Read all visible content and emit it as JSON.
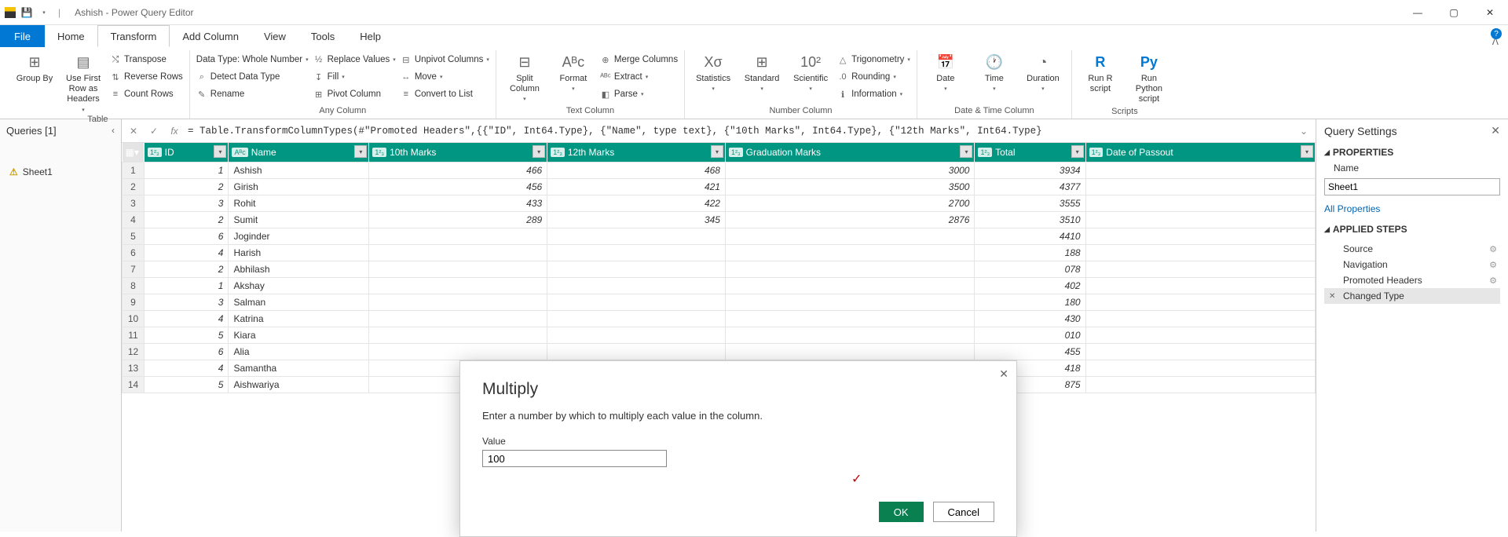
{
  "title": {
    "app_prefix": "Ashish",
    "app_name": "Power Query Editor"
  },
  "tabs": {
    "file": "File",
    "list": [
      "Home",
      "Transform",
      "Add Column",
      "View",
      "Tools",
      "Help"
    ],
    "active": 1
  },
  "ribbon": {
    "table_group": {
      "label": "Table",
      "group_by": "Group\nBy",
      "use_first_row": "Use First Row\nas Headers",
      "transpose": "Transpose",
      "reverse_rows": "Reverse Rows",
      "count_rows": "Count Rows"
    },
    "any_column_group": {
      "label": "Any Column",
      "data_type": "Data Type: Whole Number",
      "detect": "Detect Data Type",
      "rename": "Rename",
      "replace_values": "Replace Values",
      "fill": "Fill",
      "pivot": "Pivot Column",
      "unpivot": "Unpivot Columns",
      "move": "Move",
      "convert_list": "Convert to List"
    },
    "text_group": {
      "label": "Text Column",
      "split": "Split\nColumn",
      "format": "Format",
      "merge": "Merge Columns",
      "extract": "Extract",
      "parse": "Parse"
    },
    "number_group": {
      "label": "Number Column",
      "stats": "Statistics",
      "standard": "Standard",
      "scientific": "Scientific",
      "trig": "Trigonometry",
      "rounding": "Rounding",
      "info": "Information"
    },
    "datetime_group": {
      "label": "Date & Time Column",
      "date": "Date",
      "time": "Time",
      "duration": "Duration"
    },
    "scripts_group": {
      "label": "Scripts",
      "r": "Run R\nscript",
      "py": "Run Python\nscript"
    }
  },
  "formula_bar": {
    "text": "= Table.TransformColumnTypes(#\"Promoted Headers\",{{\"ID\", Int64.Type}, {\"Name\", type text}, {\"10th Marks\", Int64.Type}, {\"12th Marks\", Int64.Type}"
  },
  "queries_pane": {
    "header": "Queries [1]",
    "items": [
      "Sheet1"
    ]
  },
  "columns": [
    "ID",
    "Name",
    "10th Marks",
    "12th Marks",
    "Graduation Marks",
    "Total",
    "Date of Passout"
  ],
  "col_types": [
    "1²₃",
    "Aᴮc",
    "1²₃",
    "1²₃",
    "1²₃",
    "1²₃",
    "1²₃"
  ],
  "chart_data": {
    "type": "table",
    "columns": [
      "ID",
      "Name",
      "10th Marks",
      "12th Marks",
      "Graduation Marks",
      "Total"
    ],
    "rows": [
      [
        1,
        "Ashish",
        466,
        468,
        3000,
        3934
      ],
      [
        2,
        "Girish",
        456,
        421,
        3500,
        4377
      ],
      [
        3,
        "Rohit",
        433,
        422,
        2700,
        3555
      ],
      [
        2,
        "Sumit",
        289,
        345,
        2876,
        3510
      ],
      [
        6,
        "Joginder",
        null,
        null,
        null,
        4410
      ],
      [
        4,
        "Harish",
        null,
        null,
        null,
        "188"
      ],
      [
        2,
        "Abhilash",
        null,
        null,
        null,
        "078"
      ],
      [
        1,
        "Akshay",
        null,
        null,
        null,
        "402"
      ],
      [
        3,
        "Salman",
        null,
        null,
        null,
        "180"
      ],
      [
        4,
        "Katrina",
        null,
        null,
        null,
        "430"
      ],
      [
        5,
        "Kiara",
        null,
        null,
        null,
        "010"
      ],
      [
        6,
        "Alia",
        null,
        null,
        null,
        "455"
      ],
      [
        4,
        "Samantha",
        null,
        null,
        null,
        "418"
      ],
      [
        5,
        "Aishwariya",
        null,
        null,
        null,
        "875"
      ]
    ]
  },
  "settings": {
    "title": "Query Settings",
    "properties": "PROPERTIES",
    "name_label": "Name",
    "name_value": "Sheet1",
    "all_props": "All Properties",
    "applied_steps": "APPLIED STEPS",
    "steps": [
      {
        "label": "Source",
        "gear": true
      },
      {
        "label": "Navigation",
        "gear": true
      },
      {
        "label": "Promoted Headers",
        "gear": true
      },
      {
        "label": "Changed Type",
        "gear": false,
        "selected": true
      }
    ]
  },
  "dialog": {
    "title": "Multiply",
    "desc": "Enter a number by which to multiply each value in the column.",
    "value_label": "Value",
    "value": "100",
    "ok": "OK",
    "cancel": "Cancel"
  }
}
